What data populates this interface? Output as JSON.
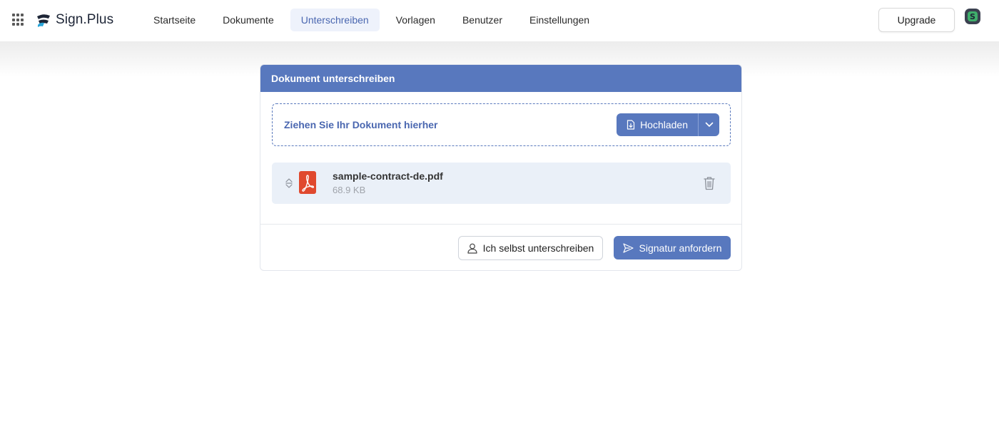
{
  "header": {
    "logo_text": "Sign.Plus",
    "nav": [
      {
        "label": "Startseite",
        "active": false
      },
      {
        "label": "Dokumente",
        "active": false
      },
      {
        "label": "Unterschreiben",
        "active": true
      },
      {
        "label": "Vorlagen",
        "active": false
      },
      {
        "label": "Benutzer",
        "active": false
      },
      {
        "label": "Einstellungen",
        "active": false
      }
    ],
    "upgrade_label": "Upgrade",
    "avatar_letter": "S"
  },
  "card": {
    "title": "Dokument unterschreiben",
    "dropzone_text": "Ziehen Sie Ihr Dokument hierher",
    "upload_label": "Hochladen",
    "file": {
      "name": "sample-contract-de.pdf",
      "size": "68.9 KB"
    },
    "self_sign_label": "Ich selbst unterschreiben",
    "request_label": "Signatur anfordern"
  },
  "colors": {
    "primary": "#5878be",
    "active_nav_bg": "#eef2fb",
    "file_row_bg": "#eaf0f8",
    "pdf_red": "#e0492e"
  }
}
